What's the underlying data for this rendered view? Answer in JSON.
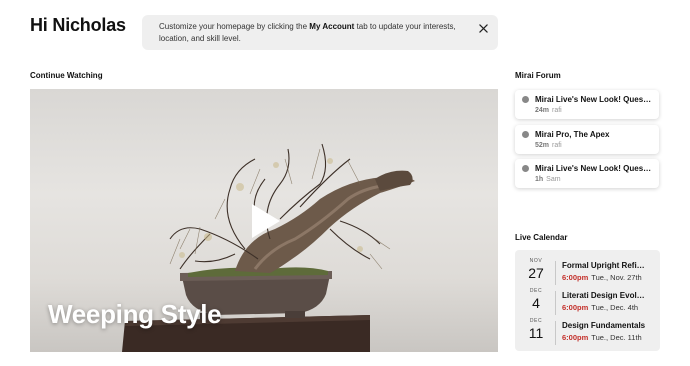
{
  "header": {
    "greeting": "Hi Nicholas",
    "notice": {
      "text_before": "Customize your homepage by clicking the ",
      "link": "My Account",
      "text_after": " tab to update your interests, location, and skill level."
    }
  },
  "continue_watching": {
    "title": "Continue Watching",
    "video_caption": "Weeping Style"
  },
  "forum": {
    "title": "Mirai Forum",
    "posts": [
      {
        "title": "Mirai Live's New Look! Ques…",
        "time": "24m",
        "author": "rafi"
      },
      {
        "title": "Mirai Pro, The Apex",
        "time": "52m",
        "author": "rafi"
      },
      {
        "title": "Mirai Live's New Look! Ques…",
        "time": "1h",
        "author": "Sam"
      }
    ]
  },
  "calendar": {
    "title": "Live Calendar",
    "events": [
      {
        "month": "NOV",
        "day": "27",
        "title": "Formal Upright Refi…",
        "time": "6:00pm",
        "date": "Tue., Nov. 27th"
      },
      {
        "month": "DEC",
        "day": "4",
        "title": "Literati Design Evol…",
        "time": "6:00pm",
        "date": "Tue., Dec. 4th"
      },
      {
        "month": "DEC",
        "day": "11",
        "title": "Design Fundamentals",
        "time": "6:00pm",
        "date": "Tue., Dec. 11th"
      }
    ]
  },
  "colors": {
    "accent_time": "#c4302b",
    "panel_bg": "#efefef",
    "forum_dot": "#888888"
  },
  "icons": {
    "close": "close-icon",
    "play": "play-icon",
    "forum_bullet": "dot-icon"
  }
}
